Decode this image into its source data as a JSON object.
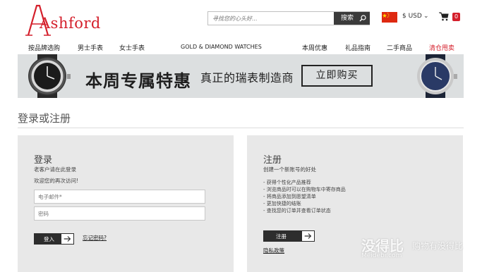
{
  "header": {
    "logo_text": "Ashford",
    "search": {
      "placeholder": "寻找您的心头好...",
      "button_label": "搜索"
    },
    "currency": "$ USD",
    "cart_count": "0"
  },
  "nav": {
    "items": [
      {
        "label": "按品牌选购"
      },
      {
        "label": "男士手表"
      },
      {
        "label": "女士手表"
      },
      {
        "label": "GOLD & DIAMOND WATCHES"
      },
      {
        "label": "本周优惠"
      },
      {
        "label": "礼品指南"
      },
      {
        "label": "二手商品"
      },
      {
        "label": "清仓甩卖"
      }
    ]
  },
  "banner": {
    "title": "本周专属特惠",
    "subtitle": "真正的瑞表制造商",
    "button_label": "立即购买"
  },
  "page_title": "登录或注册",
  "login": {
    "heading": "登录",
    "subheading": "老客户请在此登录",
    "welcome": "欢迎您的再次访问!",
    "email_placeholder": "电子邮件*",
    "password_placeholder": "密码",
    "submit_label": "登入",
    "forgot_label": "忘记密码?"
  },
  "register": {
    "heading": "注册",
    "subheading": "创建一个新账号的好处",
    "benefits": [
      "- 获得个性化产品推荐",
      "- 浏览商品时可以在购物车中寄存商品",
      "- 将商品添加到愿望清单",
      "- 更加快捷的结账",
      "- 查找您的订单并查看订单状态"
    ],
    "submit_label": "注册",
    "privacy_label": "隐私政策"
  },
  "watermark": {
    "brand": "没得比",
    "url": "Meidebi.com",
    "slogan": "购物有没得比"
  },
  "colors": {
    "brand_red": "#d41f2b",
    "dark": "#2d2d2d",
    "panel_bg": "#e8e8e8"
  }
}
